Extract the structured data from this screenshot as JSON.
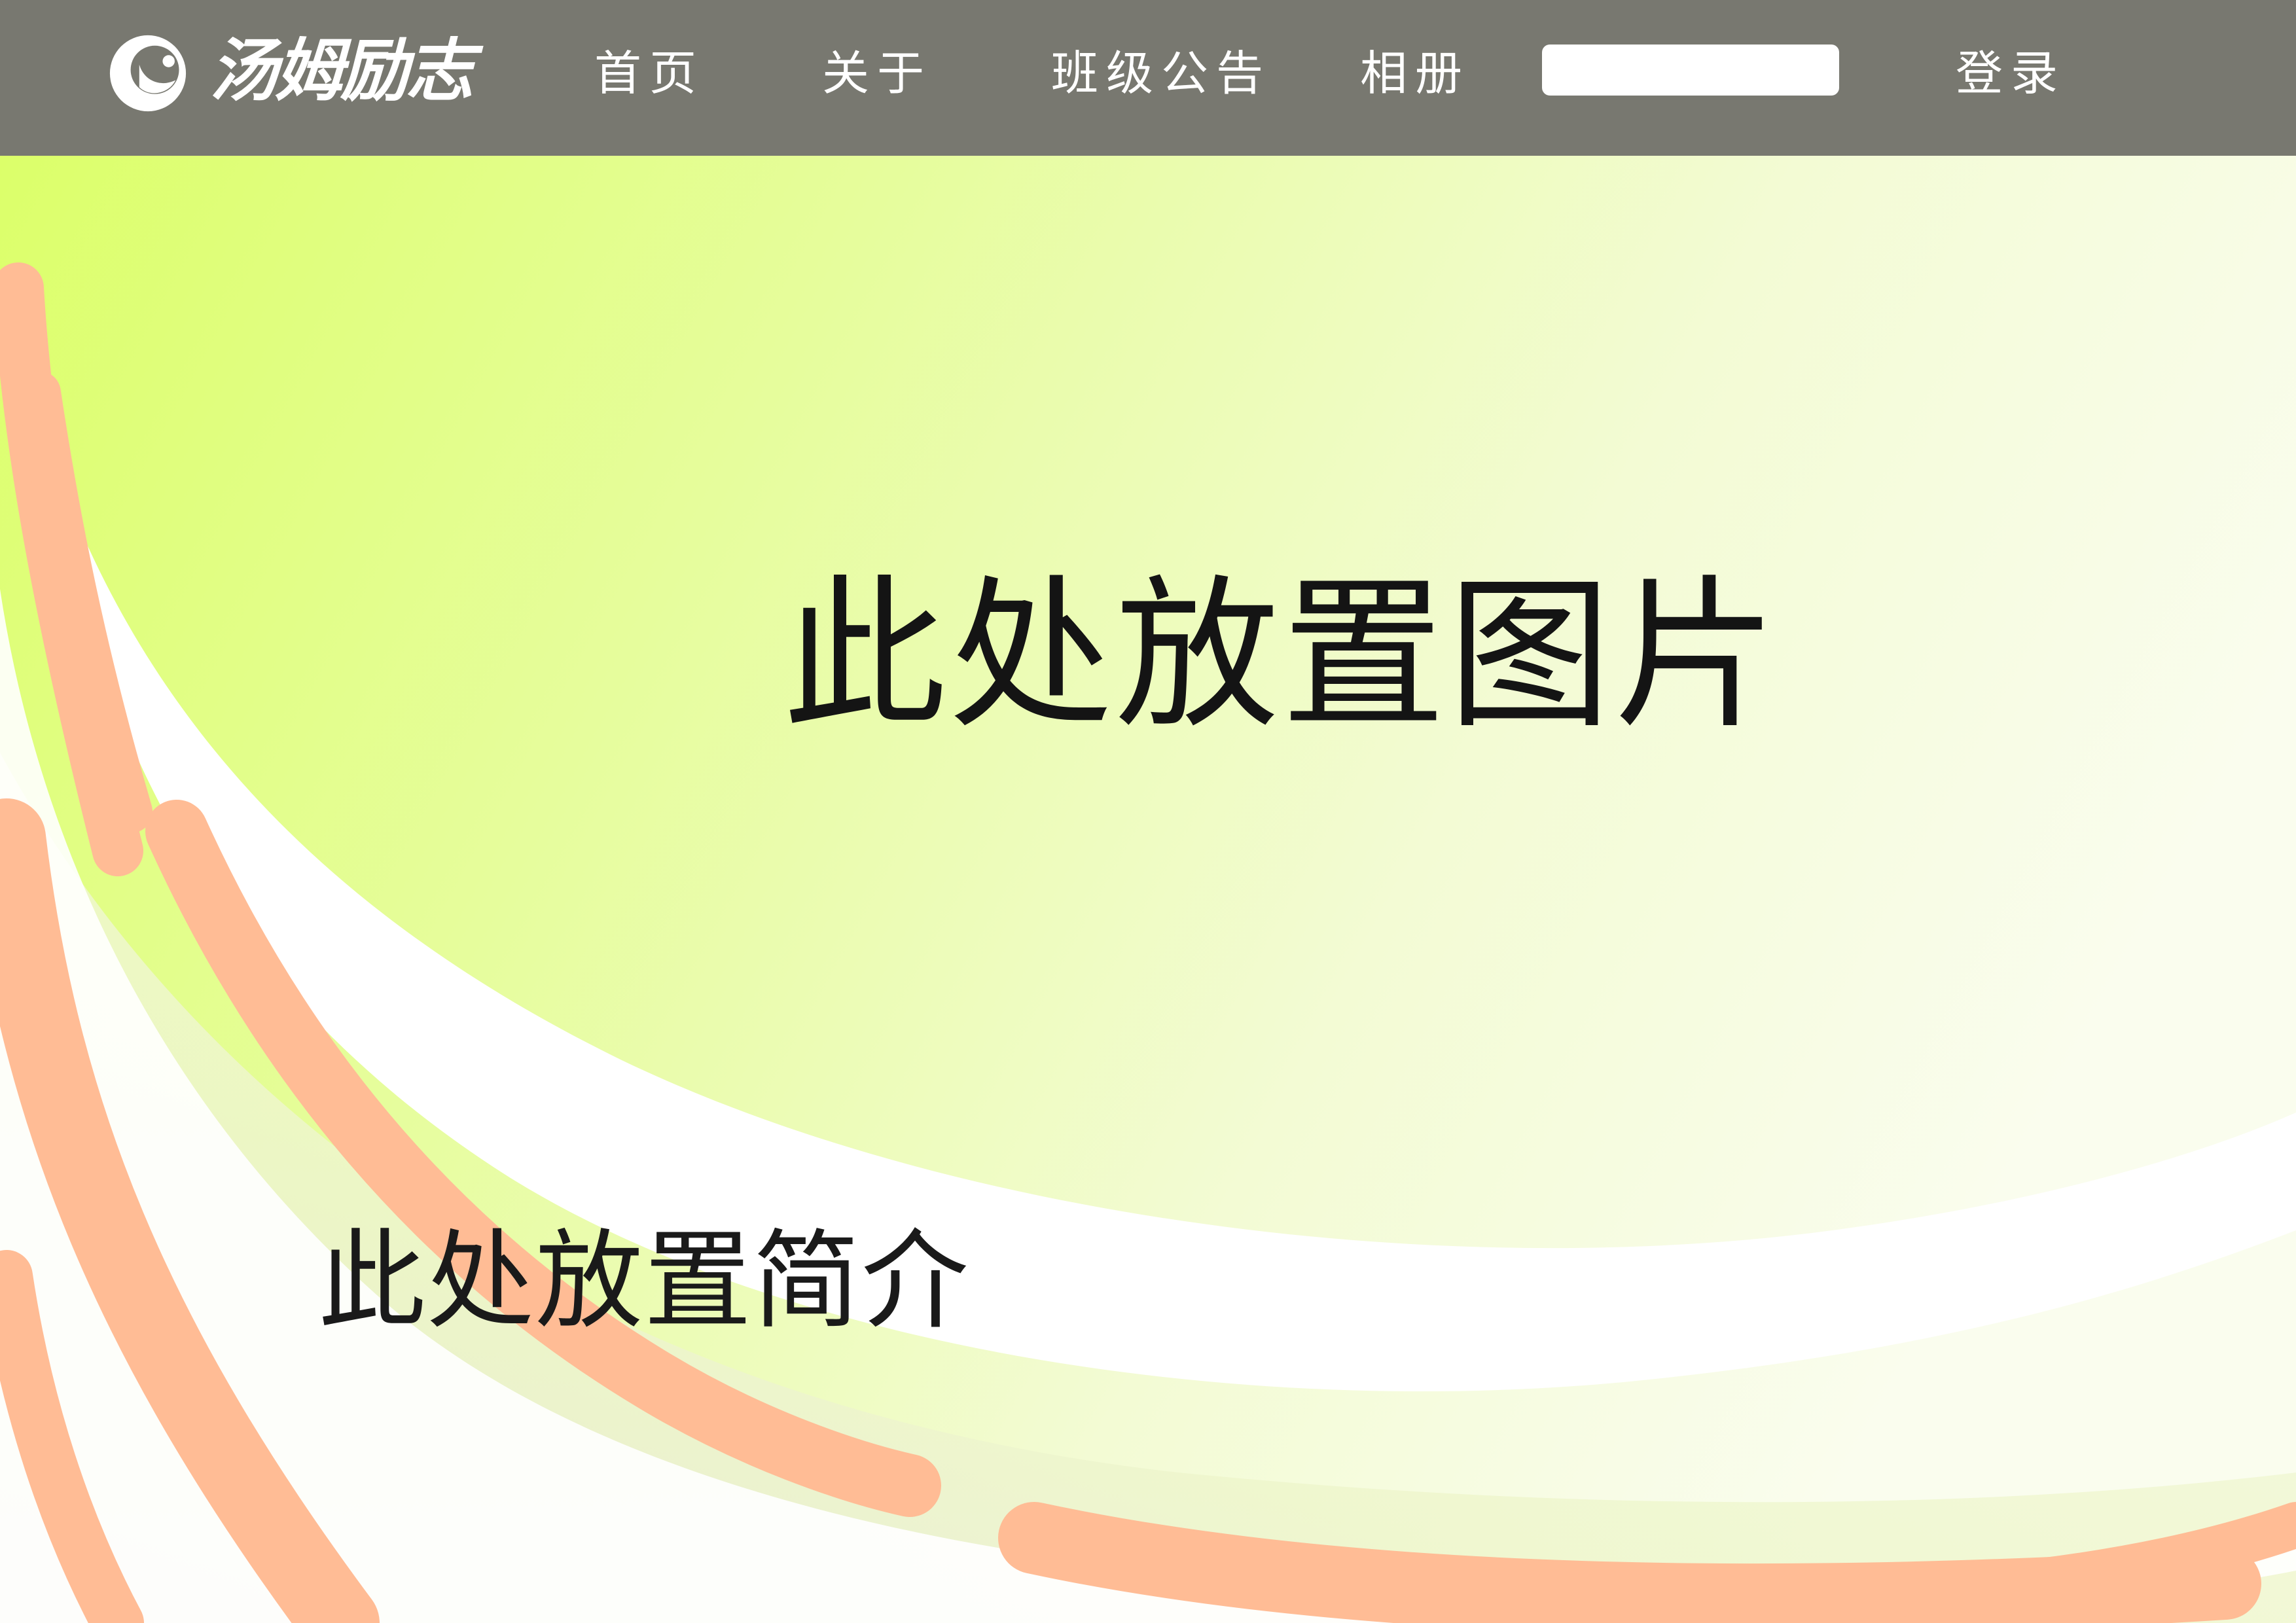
{
  "brand": {
    "name": "汤姆励志"
  },
  "nav": {
    "home": "首页",
    "about": "关于",
    "notice": "班级公告",
    "album": "相册",
    "login": "登录"
  },
  "search": {
    "value": "",
    "placeholder": ""
  },
  "hero": {
    "image_placeholder": "此处放置图片",
    "intro_placeholder": "此处放置简介"
  },
  "colors": {
    "navbar": "#787870",
    "lime": "#dcff6e",
    "peach": "#ffbc95",
    "white": "#ffffff",
    "text": "#141414"
  }
}
